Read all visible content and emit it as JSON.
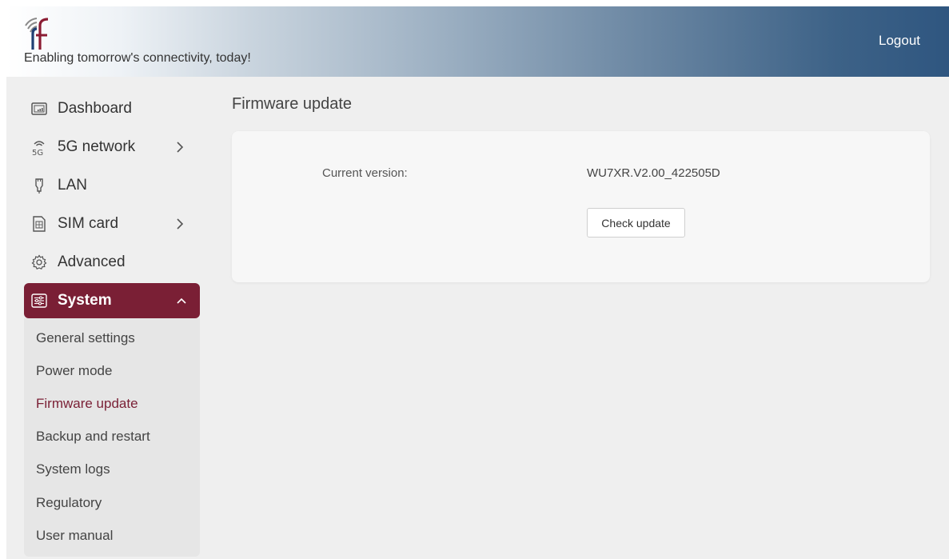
{
  "header": {
    "tagline": "Enabling tomorrow's connectivity, today!",
    "logout_label": "Logout",
    "logo_icon": "rf-signal-logo"
  },
  "sidebar": {
    "items": [
      {
        "label": "Dashboard",
        "icon": "dashboard-icon",
        "has_submenu": false
      },
      {
        "label": "5G network",
        "icon": "5g-icon",
        "has_submenu": true
      },
      {
        "label": "LAN",
        "icon": "ethernet-plug-icon",
        "has_submenu": false
      },
      {
        "label": "SIM card",
        "icon": "sim-card-icon",
        "has_submenu": true
      },
      {
        "label": "Advanced",
        "icon": "gear-icon",
        "has_submenu": false
      },
      {
        "label": "System",
        "icon": "system-sliders-icon",
        "has_submenu": true,
        "expanded": true
      }
    ],
    "system_submenu": [
      {
        "label": "General settings"
      },
      {
        "label": "Power mode"
      },
      {
        "label": "Firmware update",
        "current": true
      },
      {
        "label": "Backup and restart"
      },
      {
        "label": "System logs"
      },
      {
        "label": "Regulatory"
      },
      {
        "label": "User manual"
      }
    ]
  },
  "main": {
    "title": "Firmware update",
    "current_version_label": "Current version:",
    "current_version_value": "WU7XR.V2.00_422505D",
    "check_update_label": "Check update"
  },
  "colors": {
    "accent": "#7a1f35",
    "header_dark": "#2f5680",
    "background": "#efefef",
    "card": "#f7f7f7"
  }
}
